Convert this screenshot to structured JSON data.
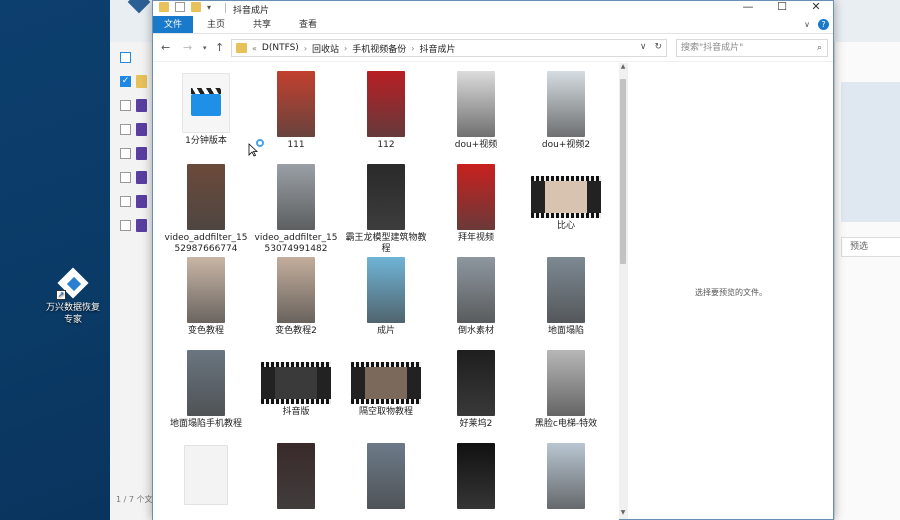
{
  "desktop": {
    "icon_label": "万兴数据恢复专家"
  },
  "background_app": {
    "status_text": "1 / 7 个文",
    "preview_button": "预选"
  },
  "explorer": {
    "title": "抖音成片",
    "window_buttons": [
      "—",
      "☐",
      "✕"
    ],
    "ribbon_tabs": [
      "文件",
      "主页",
      "共享",
      "查看"
    ],
    "breadcrumb": [
      "D(NTFS)",
      "回收站",
      "手机视频备份",
      "抖音成片"
    ],
    "breadcrumb_prefix": "«",
    "search_placeholder": "搜索\"抖音成片\"",
    "preview_message": "选择要预览的文件。",
    "items": [
      {
        "label": "1分钟版本",
        "kind": "clap",
        "color": "#ffffff"
      },
      {
        "label": "111",
        "kind": "portrait",
        "color": "#c2402e"
      },
      {
        "label": "112",
        "kind": "portrait",
        "color": "#b81f25"
      },
      {
        "label": "dou+视频",
        "kind": "portrait",
        "color": "#dcdcdc"
      },
      {
        "label": "dou+视频2",
        "kind": "portrait",
        "color": "#d6dde2"
      },
      {
        "label": "video_addfilter_1552987666774",
        "kind": "portrait",
        "color": "#6b4a3a"
      },
      {
        "label": "video_addfilter_1553074991482",
        "kind": "portrait",
        "color": "#9aa0a6"
      },
      {
        "label": "霸王龙模型建筑物教程",
        "kind": "portrait",
        "color": "#2a2a2a"
      },
      {
        "label": "拜年视频",
        "kind": "portrait",
        "color": "#c8201e"
      },
      {
        "label": "比心",
        "kind": "wide",
        "color": "#d8c2b0"
      },
      {
        "label": "变色教程",
        "kind": "portrait",
        "color": "#c9b6a6"
      },
      {
        "label": "变色教程2",
        "kind": "portrait",
        "color": "#c4ae9c"
      },
      {
        "label": "成片",
        "kind": "portrait",
        "color": "#6fb4d6"
      },
      {
        "label": "倒水素材",
        "kind": "portrait",
        "color": "#8e979f"
      },
      {
        "label": "地面塌陷",
        "kind": "portrait",
        "color": "#7d8993"
      },
      {
        "label": "地面塌陷手机教程",
        "kind": "portrait",
        "color": "#6a7680"
      },
      {
        "label": "抖音版",
        "kind": "wide",
        "color": "#3a3a3a"
      },
      {
        "label": "隔空取物教程",
        "kind": "wide",
        "color": "#7b6a5c"
      },
      {
        "label": "好莱坞2",
        "kind": "portrait",
        "color": "#1e1e1e"
      },
      {
        "label": "黑脸c电梯-特效",
        "kind": "portrait",
        "color": "#b7b7b7"
      },
      {
        "label": "",
        "kind": "doc",
        "color": "#f3f3f3"
      },
      {
        "label": "",
        "kind": "portrait",
        "color": "#3a2a2a"
      },
      {
        "label": "",
        "kind": "portrait",
        "color": "#6c7a88"
      },
      {
        "label": "",
        "kind": "portrait",
        "color": "#111111"
      },
      {
        "label": "",
        "kind": "portrait",
        "color": "#b9c6d2"
      }
    ]
  },
  "colors": {
    "accent": "#1979ca",
    "folder": "#e8c15a",
    "desktop_bg": "#0a3a66"
  }
}
